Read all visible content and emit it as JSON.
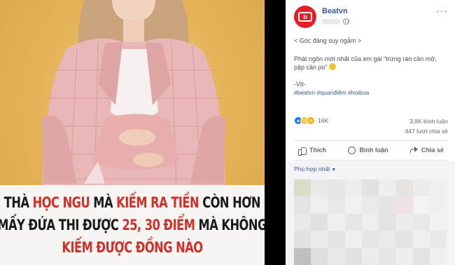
{
  "photo": {
    "caption_lines": [
      [
        "THÀ ",
        "HỌC NGU",
        " MÀ ",
        "KIẾM RA TIỀN",
        " CÒN HƠN"
      ],
      [
        "MẤY ĐỨA THI ĐƯỢC ",
        "25, 30 ĐIỂM",
        " MÀ KHÔNG"
      ],
      [
        "KIẾM ĐƯỢC ĐỒNG NÀO"
      ]
    ],
    "caption_highlight_color": "#d0302a",
    "background_color": "#e8b85a",
    "jacket_color": "#e9b7b7"
  },
  "post": {
    "page_name": "Beatvn",
    "avatar_logo_text": "b",
    "brand_color": "#e41e26",
    "more_icon": "more-horizontal-icon",
    "privacy_icon": "globe-icon",
    "text": {
      "category": "< Góc đáng suy ngẫm >",
      "quote": "Phát ngôn mới nhất của em gái \"trứng rán cần mở, pập cần po\"",
      "author": "-Vịt-",
      "hashtags": "#beatvn #quanđiểm #hoibua"
    },
    "reactions": {
      "icons": [
        "like-icon",
        "haha-icon",
        "wow-icon"
      ],
      "count": "16K"
    },
    "stats": {
      "comments": "3,8K bình luận",
      "shares": "447 lượt chia sẻ"
    },
    "actions": {
      "like": "Thích",
      "comment": "Bình luận",
      "share": "Chia sẻ"
    },
    "comments_sort": "Phù hợp nhất"
  }
}
